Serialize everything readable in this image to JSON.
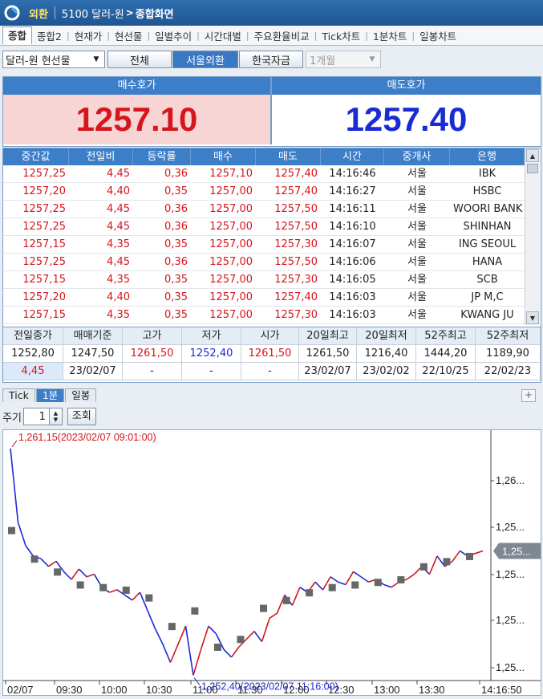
{
  "titlebar": {
    "menu": "외환",
    "code_title": "5100 달러-원",
    "screen": "종합화면"
  },
  "tabs": [
    "종합",
    "종합2",
    "현재가",
    "현선물",
    "일별추이",
    "시간대별",
    "주요환율비교",
    "Tick차트",
    "1분차트",
    "일봉차트"
  ],
  "controls": {
    "instrument": "달러-원 현선물",
    "filters": [
      "전체",
      "서울외환",
      "한국자금"
    ],
    "active_filter": "서울외환",
    "term": "1개월"
  },
  "quotes": {
    "bid_label": "매수호가",
    "bid": "1257.10",
    "ask_label": "매도호가",
    "ask": "1257.40",
    "bid_color": "#d6151c",
    "ask_color": "#1b2bd4"
  },
  "tick_table": {
    "columns": [
      "중간값",
      "전일비",
      "등락률",
      "매수",
      "매도",
      "시간",
      "중개사",
      "은행"
    ],
    "rows": [
      [
        "1257,25",
        "4,45",
        "0,36",
        "1257,10",
        "1257,40",
        "14:16:46",
        "서울",
        "IBK"
      ],
      [
        "1257,20",
        "4,40",
        "0,35",
        "1257,00",
        "1257,40",
        "14:16:27",
        "서울",
        "HSBC"
      ],
      [
        "1257,25",
        "4,45",
        "0,36",
        "1257,00",
        "1257,50",
        "14:16:11",
        "서울",
        "WOORI BANK"
      ],
      [
        "1257,25",
        "4,45",
        "0,36",
        "1257,00",
        "1257,50",
        "14:16:10",
        "서울",
        "SHINHAN"
      ],
      [
        "1257,15",
        "4,35",
        "0,35",
        "1257,00",
        "1257,30",
        "14:16:07",
        "서울",
        "ING SEOUL"
      ],
      [
        "1257,25",
        "4,45",
        "0,36",
        "1257,00",
        "1257,50",
        "14:16:06",
        "서울",
        "HANA"
      ],
      [
        "1257,15",
        "4,35",
        "0,35",
        "1257,00",
        "1257,30",
        "14:16:05",
        "서울",
        "SCB"
      ],
      [
        "1257,20",
        "4,40",
        "0,35",
        "1257,00",
        "1257,40",
        "14:16:03",
        "서울",
        "JP M,C"
      ],
      [
        "1257,15",
        "4,35",
        "0,35",
        "1257,00",
        "1257,30",
        "14:16:03",
        "서울",
        "KWANG JU"
      ]
    ]
  },
  "summary": {
    "headers": [
      "전일종가",
      "매매기준",
      "고가",
      "저가",
      "시가",
      "20일최고",
      "20일최저",
      "52주최고",
      "52주최저"
    ],
    "values": [
      "1252,80",
      "1247,50",
      "1261,50",
      "1252,40",
      "1261,50",
      "1261,50",
      "1216,40",
      "1444,20",
      "1189,90"
    ],
    "dates": [
      "4,45",
      "23/02/07",
      "-",
      "-",
      "-",
      "23/02/07",
      "23/02/02",
      "22/10/25",
      "22/02/23"
    ]
  },
  "chart_tabs": [
    "Tick",
    "1분",
    "일봉"
  ],
  "active_chart_tab": "1분",
  "period": {
    "label": "주기",
    "value": "1",
    "query_button": "조회"
  },
  "chart_data": {
    "type": "line",
    "x_labels": [
      "02/07",
      "09:30",
      "10:00",
      "10:30",
      "11:00",
      "11:30",
      "12:00",
      "12:30",
      "13:00",
      "13:30",
      "14:16:50"
    ],
    "y_labels": [
      "1,26...",
      "1,25...",
      "1,25...",
      "1,25...",
      "1,25..."
    ],
    "current_label": "1,25...",
    "high_annotation": "1,261,15(2023/02/07 09:01:00)",
    "low_annotation": "1,252,40(2023/02/07 11:16:00)",
    "up_color": "#d6151c",
    "down_color": "#1b2bd4",
    "ylim": [
      1252.2,
      1261.3
    ],
    "series": [
      {
        "values": [
          1261.15,
          1258.3,
          1257.4,
          1257.0,
          1256.9,
          1256.6,
          1256.8,
          1256.4,
          1256.1,
          1256.5,
          1256.2,
          1256.3,
          1255.8,
          1255.6,
          1255.7,
          1255.5,
          1255.3,
          1255.6,
          1254.9,
          1254.2,
          1253.6,
          1252.9,
          1253.6,
          1254.3,
          1252.4,
          1253.4,
          1254.3,
          1254.0,
          1253.4,
          1253.1,
          1253.5,
          1253.8,
          1254.1,
          1253.7,
          1254.6,
          1254.8,
          1255.5,
          1255.1,
          1255.8,
          1255.6,
          1256.0,
          1255.7,
          1256.2,
          1256.0,
          1255.9,
          1256.4,
          1256.2,
          1256.0,
          1256.1,
          1255.9,
          1255.8,
          1256.0,
          1256.1,
          1256.3,
          1256.6,
          1256.3,
          1257.0,
          1256.6,
          1256.8,
          1257.2,
          1257.0,
          1257.1,
          1257.2
        ]
      }
    ],
    "markers": [
      1258.0,
      1256.9,
      1256.4,
      1255.9,
      1255.8,
      1255.7,
      1255.4,
      1254.3,
      1254.9,
      1253.5,
      1253.8,
      1255.0,
      1255.3,
      1255.6,
      1255.8,
      1255.9,
      1256.0,
      1256.1,
      1256.6,
      1256.8,
      1257.0
    ]
  }
}
